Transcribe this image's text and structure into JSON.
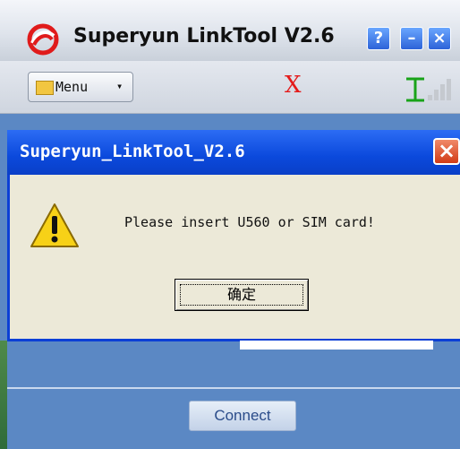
{
  "main_window": {
    "title": "Superyun LinkTool V2.6",
    "help_glyph": "?",
    "minimize_glyph": "–",
    "close_glyph": "×"
  },
  "toolbar": {
    "menu_label": "Menu",
    "menu_caret": "▾",
    "status_x": "X"
  },
  "dialog": {
    "title": "Superyun_LinkTool_V2.6",
    "close_glyph": "×",
    "message": "Please insert U560 or SIM card!",
    "ok_label": "确定"
  },
  "bottom": {
    "connect_label": "Connect"
  },
  "icons": {
    "logo": "superyun-logo-icon",
    "menu": "folder-icon",
    "signal": "signal-strength-icon",
    "warning": "warning-icon"
  },
  "colors": {
    "dialog_title": "#0b49dc",
    "status_x": "#e41a1a",
    "signal": "#19a319"
  }
}
